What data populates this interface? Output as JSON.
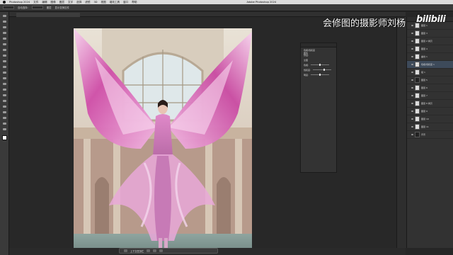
{
  "menubar": {
    "app_name": "Photoshop 2024",
    "items": [
      "文件",
      "编辑",
      "图像",
      "图层",
      "文字",
      "选择",
      "滤镜",
      "3D",
      "视图",
      "增效工具",
      "窗口",
      "帮助"
    ],
    "center_title": "Adobe Photoshop 2024"
  },
  "optionbar": {
    "items": [
      "自动选择:",
      "图层",
      "显示变换控件"
    ]
  },
  "document": {
    "tab_title": "天使翅膀.psd @ 25%"
  },
  "overlay": {
    "caption": "会修图的摄影师刘杨",
    "logo": "bilibili"
  },
  "properties": {
    "title": "属性",
    "type": "色相/饱和度",
    "preset_label": "预设:",
    "channel_label": "全图",
    "sliders": [
      {
        "label": "色相:",
        "value": 0.5
      },
      {
        "label": "饱和度:",
        "value": 0.62
      },
      {
        "label": "明度:",
        "value": 0.5
      }
    ]
  },
  "layers": {
    "items": [
      {
        "name": "图层 1",
        "selected": false,
        "dark": false
      },
      {
        "name": "图层 3",
        "selected": false,
        "dark": false
      },
      {
        "name": "图层 2 拷贝",
        "selected": false,
        "dark": false
      },
      {
        "name": "图层 4",
        "selected": false,
        "dark": false
      },
      {
        "name": "曲线 1",
        "selected": false,
        "dark": false
      },
      {
        "name": "色相/饱和度 1",
        "selected": true,
        "dark": false
      },
      {
        "name": "组 1",
        "selected": false,
        "dark": false
      },
      {
        "name": "图层 5",
        "selected": false,
        "dark": true
      },
      {
        "name": "图层 6",
        "selected": false,
        "dark": false
      },
      {
        "name": "图层 7",
        "selected": false,
        "dark": false
      },
      {
        "name": "图层 8 拷贝",
        "selected": false,
        "dark": false
      },
      {
        "name": "图层 9",
        "selected": false,
        "dark": false
      },
      {
        "name": "图层 10",
        "selected": false,
        "dark": false
      },
      {
        "name": "图层 11",
        "selected": false,
        "dark": false
      },
      {
        "name": "背景",
        "selected": false,
        "dark": true
      }
    ]
  },
  "taskbar": {
    "label": "上下文任务栏"
  }
}
